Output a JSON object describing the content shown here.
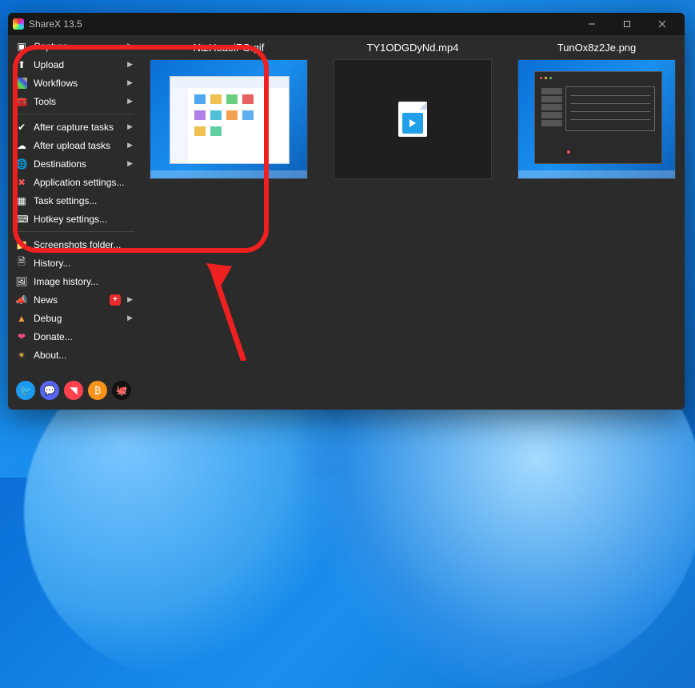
{
  "titlebar": {
    "title": "ShareX 13.5"
  },
  "sidebar": {
    "group1": [
      {
        "label": "Capture",
        "icon": "▣",
        "sub": true
      },
      {
        "label": "Upload",
        "icon": "⬆",
        "sub": true
      },
      {
        "label": "Workflows",
        "icon": "⋮⋮",
        "sub": true
      },
      {
        "label": "Tools",
        "icon": "🧰",
        "sub": true
      }
    ],
    "group2": [
      {
        "label": "After capture tasks",
        "icon": "✔",
        "sub": true
      },
      {
        "label": "After upload tasks",
        "icon": "☁",
        "sub": true
      },
      {
        "label": "Destinations",
        "icon": "🌐",
        "sub": true
      },
      {
        "label": "Application settings...",
        "icon": "✖",
        "sub": false
      },
      {
        "label": "Task settings...",
        "icon": "▦",
        "sub": false
      },
      {
        "label": "Hotkey settings...",
        "icon": "⌨",
        "sub": false
      }
    ],
    "group3": [
      {
        "label": "Screenshots folder...",
        "icon": "📁",
        "sub": false
      },
      {
        "label": "History...",
        "icon": "🗎",
        "sub": false
      },
      {
        "label": "Image history...",
        "icon": "🖼",
        "sub": false
      },
      {
        "label": "News",
        "icon": "📣",
        "sub": true,
        "badge": "+"
      },
      {
        "label": "Debug",
        "icon": "▲",
        "sub": true
      },
      {
        "label": "Donate...",
        "icon": "❤",
        "sub": false
      },
      {
        "label": "About...",
        "icon": "✴",
        "sub": false
      }
    ]
  },
  "thumbs": [
    {
      "name": "NtzHoaeiFG.gif",
      "kind": "desktop"
    },
    {
      "name": "TY1ODGDyNd.mp4",
      "kind": "video"
    },
    {
      "name": "TunOx8z2Je.png",
      "kind": "settings"
    }
  ],
  "social": [
    {
      "name": "twitter",
      "glyph": "🐦",
      "bg": "#1d9bf0"
    },
    {
      "name": "discord",
      "glyph": "💬",
      "bg": "#5865f2"
    },
    {
      "name": "patreon",
      "glyph": "◥",
      "bg": "#ff424d"
    },
    {
      "name": "bitcoin",
      "glyph": "₿",
      "bg": "#f7931a"
    },
    {
      "name": "github",
      "glyph": "🐙",
      "bg": "#111"
    }
  ],
  "colors": {
    "annotation": "#ef2020"
  }
}
